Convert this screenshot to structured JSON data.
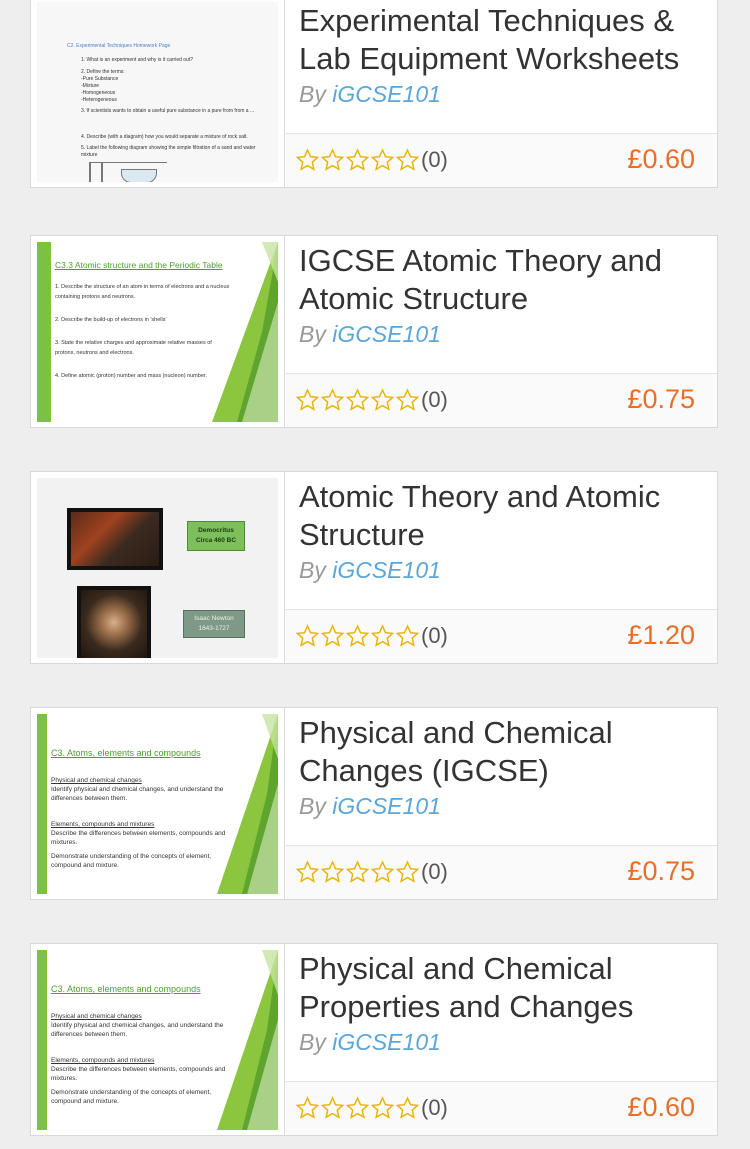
{
  "colors": {
    "price": "#e66f2c",
    "author": "#5ba6d8",
    "star_outline": "#e8b400"
  },
  "listing": [
    {
      "title": "Experimental Techniques & Lab Equipment Worksheets",
      "by": "By",
      "author": "iGCSE101",
      "rating_count": "(0)",
      "price": "£0.60",
      "stars_filled": 0,
      "thumb": {
        "kind": "worksheet",
        "heading": "C2. Experimental Techniques Homework Page",
        "lines": [
          "1.  What is an experiment and why is it carried out?",
          "2.  Define the terms:",
          "     -Pure Substance",
          "     -Mixture",
          "     -Homogeneous",
          "     -Heterogeneous",
          "3.  If scientists wants to obtain a useful pure substance in a pure from from a ...",
          "4.  Describe (with a diagram) how you would separate a mixture of rock salt.",
          "5.  Label the following diagram showing the simple filtration of a sand and water mixture"
        ]
      }
    },
    {
      "title": "IGCSE Atomic Theory and Atomic Structure",
      "by": "By",
      "author": "iGCSE101",
      "rating_count": "(0)",
      "price": "£0.75",
      "stars_filled": 0,
      "thumb": {
        "kind": "slide",
        "heading": "C3.3 Atomic structure and the Periodic Table",
        "lines": [
          "1. Describe the structure of an atom in terms of electrons and a nucleus containing protons and neutrons.",
          "2. Describe the build-up of electrons in 'shells'",
          "3. State the relative charges and approximate relative masses of protons, neutrons and electrons.",
          "4. Define atomic (proton) number and mass (nucleon) number."
        ]
      }
    },
    {
      "title": "Atomic Theory and Atomic Structure",
      "by": "By",
      "author": "iGCSE101",
      "rating_count": "(0)",
      "price": "£1.20",
      "stars_filled": 0,
      "thumb": {
        "kind": "portraits",
        "label1": "Democritus",
        "label1b": "Circa 460 BC",
        "label2": "Isaac Newton",
        "label2b": "1643-1727"
      }
    },
    {
      "title": "Physical and Chemical Changes (IGCSE)",
      "by": "By",
      "author": "iGCSE101",
      "rating_count": "(0)",
      "price": "£0.75",
      "stars_filled": 0,
      "thumb": {
        "kind": "slide",
        "heading": "C3. Atoms, elements and compounds",
        "lines": [
          "Physical and chemical changes",
          "Identify physical and chemical changes, and understand the differences between them.",
          "Elements, compounds and mixtures",
          "Describe the differences between elements, compounds and mixtures.",
          "Demonstrate understanding of the concepts of element, compound and mixture."
        ]
      }
    },
    {
      "title": "Physical and Chemical Properties and Changes",
      "by": "By",
      "author": "iGCSE101",
      "rating_count": "(0)",
      "price": "£0.60",
      "stars_filled": 0,
      "thumb": {
        "kind": "slide",
        "heading": "C3. Atoms, elements and compounds",
        "lines": [
          "Physical and chemical changes",
          "Identify physical and chemical changes, and understand the differences between them.",
          "Elements, compounds and mixtures",
          "Describe the differences between elements, compounds and mixtures.",
          "Demonstrate understanding of the concepts of element, compound and mixture."
        ]
      }
    }
  ]
}
